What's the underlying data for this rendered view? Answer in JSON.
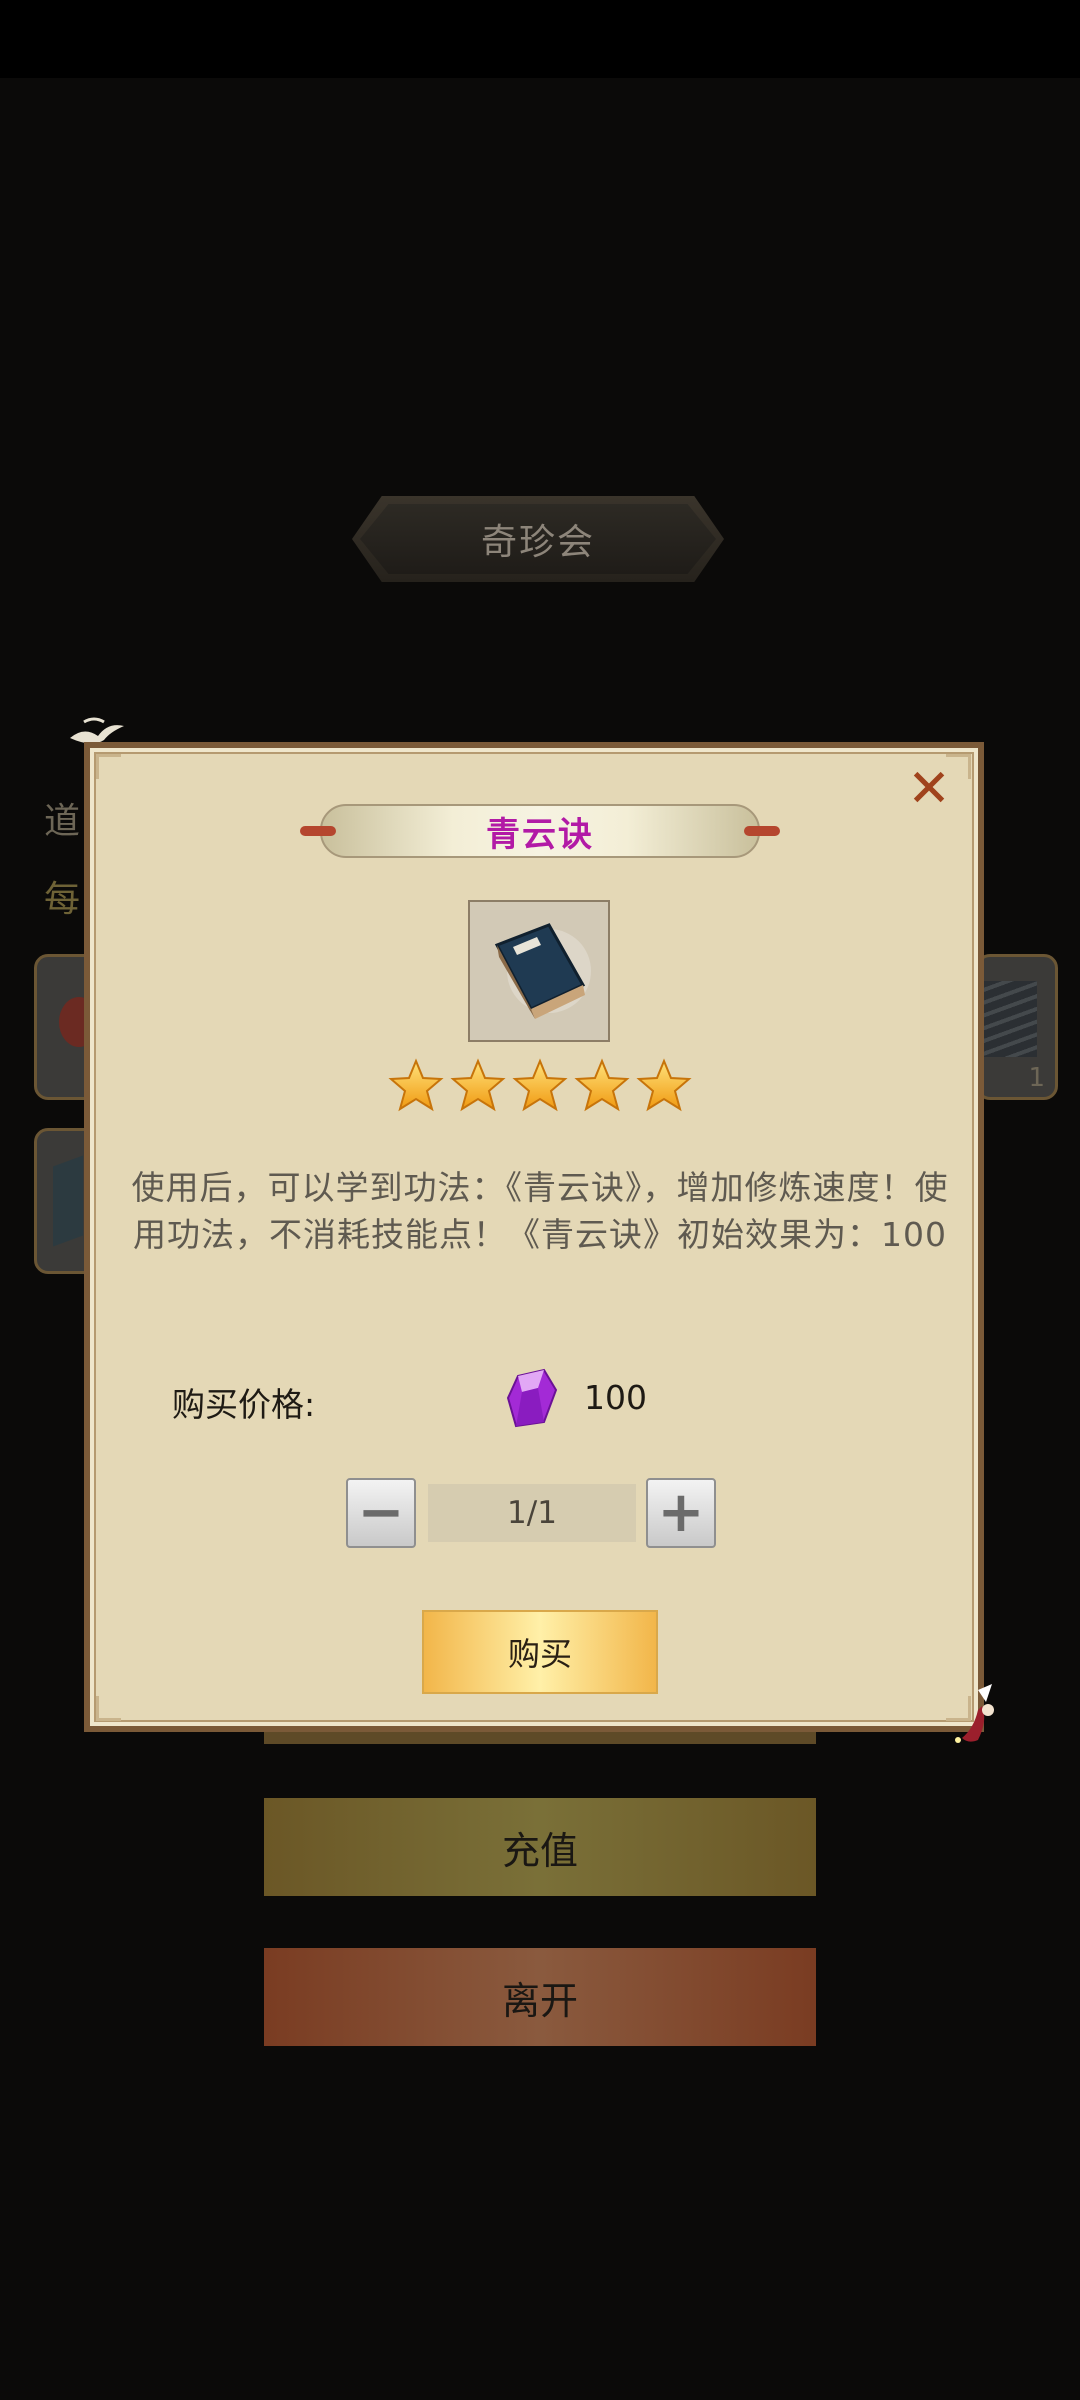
{
  "background": {
    "title": "奇珍会",
    "left_text_1": "道",
    "left_text_2": "每",
    "slot_count_text": "1",
    "buttons": {
      "recharge": "充值",
      "leave": "离开"
    }
  },
  "modal": {
    "item_name": "青云诀",
    "stars": 5,
    "description": "使用后，可以学到功法：《青云诀》，增加修炼速度！使用功法，不消耗技能点！《青云诀》初始效果为：100",
    "price_label": "购买价格:",
    "price_value": "100",
    "currency_icon": "purple-gem-icon",
    "quantity": "1/1",
    "minus_symbol": "−",
    "plus_symbol": "+",
    "buy_label": "购买",
    "close_symbol": "✕"
  },
  "colors": {
    "item_name": "#b21aa6",
    "modal_bg": "#e4d8b6",
    "close": "#a0431c"
  }
}
